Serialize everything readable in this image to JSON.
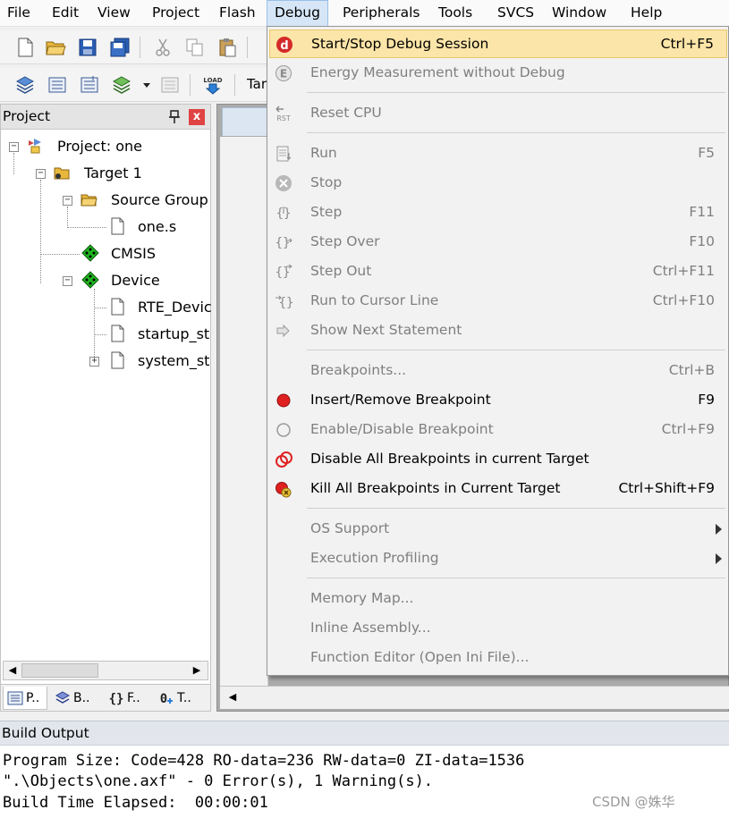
{
  "menubar": {
    "items": [
      "File",
      "Edit",
      "View",
      "Project",
      "Flash",
      "Debug",
      "Peripherals",
      "Tools",
      "SVCS",
      "Window",
      "Help"
    ],
    "active": "Debug"
  },
  "toolbar": {
    "target_partial": "Tar",
    "load_icon_text": "LOAD"
  },
  "project_panel": {
    "title": "Project",
    "close_label": "x",
    "tree": [
      {
        "label": "Project: one",
        "icon": "project-icon",
        "expander": "−"
      },
      {
        "label": "Target 1",
        "icon": "target-folder-icon",
        "expander": "−"
      },
      {
        "label": "Source Group",
        "icon": "folder-open-icon",
        "expander": "−"
      },
      {
        "label": "one.s",
        "icon": "file-icon"
      },
      {
        "label": "CMSIS",
        "icon": "green-diamond-icon"
      },
      {
        "label": "Device",
        "icon": "green-diamond-icon",
        "expander": "−"
      },
      {
        "label": "RTE_Devic",
        "icon": "file-icon"
      },
      {
        "label": "startup_st",
        "icon": "file-icon"
      },
      {
        "label": "system_st",
        "icon": "file-icon",
        "expander": "+"
      }
    ],
    "tabs": [
      {
        "label": "P..",
        "icon": "project-tab-icon"
      },
      {
        "label": "B..",
        "icon": "books-tab-icon"
      },
      {
        "label": "F..",
        "icon": "functions-tab-icon"
      },
      {
        "label": "T..",
        "icon": "templates-tab-icon"
      }
    ]
  },
  "debug_menu": {
    "items": [
      {
        "label": "Start/Stop Debug Session",
        "shortcut": "Ctrl+F5",
        "icon": "debug-session-icon",
        "enabled": true,
        "highlighted": true
      },
      {
        "label": "Energy Measurement without Debug",
        "shortcut": "",
        "icon": "energy-icon",
        "enabled": false
      },
      {
        "label": "Reset CPU",
        "shortcut": "",
        "icon": "reset-cpu-icon",
        "enabled": false
      },
      {
        "label": "Run",
        "shortcut": "F5",
        "icon": "run-icon",
        "enabled": false
      },
      {
        "label": "Stop",
        "shortcut": "",
        "icon": "stop-icon",
        "enabled": false
      },
      {
        "label": "Step",
        "shortcut": "F11",
        "icon": "step-icon",
        "enabled": false
      },
      {
        "label": "Step Over",
        "shortcut": "F10",
        "icon": "step-over-icon",
        "enabled": false
      },
      {
        "label": "Step Out",
        "shortcut": "Ctrl+F11",
        "icon": "step-out-icon",
        "enabled": false
      },
      {
        "label": "Run to Cursor Line",
        "shortcut": "Ctrl+F10",
        "icon": "run-to-cursor-icon",
        "enabled": false
      },
      {
        "label": "Show Next Statement",
        "shortcut": "",
        "icon": "next-statement-icon",
        "enabled": false
      },
      {
        "label": "Breakpoints...",
        "shortcut": "Ctrl+B",
        "icon": "",
        "enabled": false
      },
      {
        "label": "Insert/Remove Breakpoint",
        "shortcut": "F9",
        "icon": "breakpoint-icon",
        "enabled": true
      },
      {
        "label": "Enable/Disable Breakpoint",
        "shortcut": "Ctrl+F9",
        "icon": "breakpoint-outline-icon",
        "enabled": false
      },
      {
        "label": "Disable All Breakpoints in current Target",
        "shortcut": "",
        "icon": "disable-breakpoints-icon",
        "enabled": true
      },
      {
        "label": "Kill All Breakpoints in Current Target",
        "shortcut": "Ctrl+Shift+F9",
        "icon": "kill-breakpoints-icon",
        "enabled": true
      },
      {
        "label": "OS Support",
        "shortcut": "",
        "icon": "",
        "enabled": false,
        "submenu": true
      },
      {
        "label": "Execution Profiling",
        "shortcut": "",
        "icon": "",
        "enabled": false,
        "submenu": true
      },
      {
        "label": "Memory Map...",
        "shortcut": "",
        "icon": "",
        "enabled": false
      },
      {
        "label": "Inline Assembly...",
        "shortcut": "",
        "icon": "",
        "enabled": false
      },
      {
        "label": "Function Editor (Open Ini File)...",
        "shortcut": "",
        "icon": "",
        "enabled": false
      }
    ]
  },
  "build_output": {
    "title": "Build Output",
    "lines": [
      "Program Size: Code=428 RO-data=236 RW-data=0 ZI-data=1536",
      "\".\\Objects\\one.axf\" - 0 Error(s), 1 Warning(s).",
      "Build Time Elapsed:  00:00:01"
    ]
  },
  "watermark": "CSDN @姝华",
  "colors": {
    "highlight": "#fce5a8",
    "breakpoint_red": "#e02020",
    "panel_close": "#e04343",
    "active_menu": "#d6e6f7"
  }
}
